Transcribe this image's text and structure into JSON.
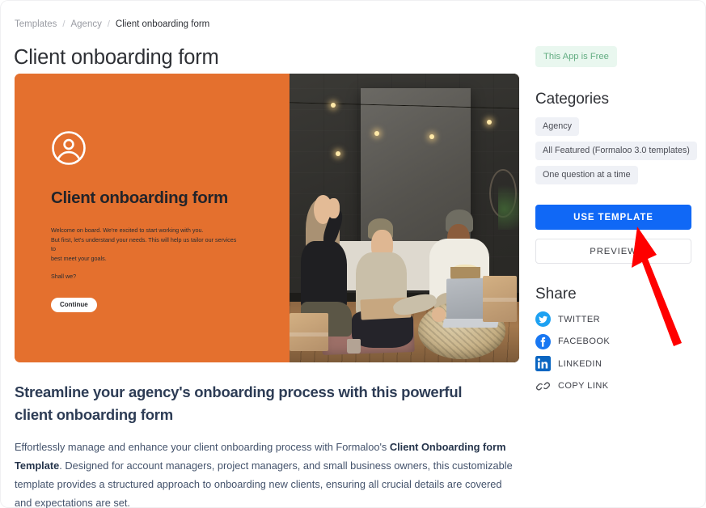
{
  "breadcrumb": {
    "items": [
      {
        "label": "Templates",
        "current": false
      },
      {
        "label": "Agency",
        "current": false
      },
      {
        "label": "Client onboarding form",
        "current": true
      }
    ],
    "separator": "/"
  },
  "page": {
    "title": "Client onboarding form"
  },
  "hero": {
    "background_color": "#E4702E",
    "avatar_icon": "user-circle-icon",
    "heading": "Client onboarding form",
    "paragraph_1_line_1": "Welcome on board. We're excited to start working with you.",
    "paragraph_1_line_2": "But first, let's understand your needs. This will help us tailor our services to",
    "paragraph_1_line_3": "best meet your goals.",
    "paragraph_2": "Shall we?",
    "continue_label": "Continue",
    "photo_alt": "Three people working together on a laptop in a loft with string lights"
  },
  "article": {
    "title": "Streamline your agency's onboarding process with this powerful client onboarding form",
    "description_part_1": "Effortlessly manage and enhance your client onboarding process with Formaloo's ",
    "description_bold": "Client Onboarding form Template",
    "description_part_2": ". Designed for account managers, project managers, and small business owners, this customizable template provides a structured approach to onboarding new clients, ensuring all crucial details are covered and expectations are set.",
    "title_color": "#2D3C55"
  },
  "rail": {
    "free_badge": "This App is Free",
    "free_badge_bg": "#E9F7EF",
    "free_badge_color": "#63AD82",
    "categories_heading": "Categories",
    "categories": [
      "Agency",
      "All Featured (Formaloo 3.0 templates)",
      "One question at a time"
    ],
    "use_template_label": "USE TEMPLATE",
    "use_template_color": "#1068F6",
    "preview_label": "PREVIEW",
    "share_heading": "Share",
    "share_items": [
      {
        "label": "TWITTER",
        "icon": "twitter-icon",
        "color": "#1DA1F2"
      },
      {
        "label": "FACEBOOK",
        "icon": "facebook-icon",
        "color": "#1877F2"
      },
      {
        "label": "LINKEDIN",
        "icon": "linkedin-icon",
        "color": "#0A66C2"
      },
      {
        "label": "COPY LINK",
        "icon": "copy-link-icon",
        "color": "#4F5157"
      }
    ]
  },
  "annotation": {
    "arrow_color": "#FF0000",
    "points_to": "USE TEMPLATE"
  }
}
